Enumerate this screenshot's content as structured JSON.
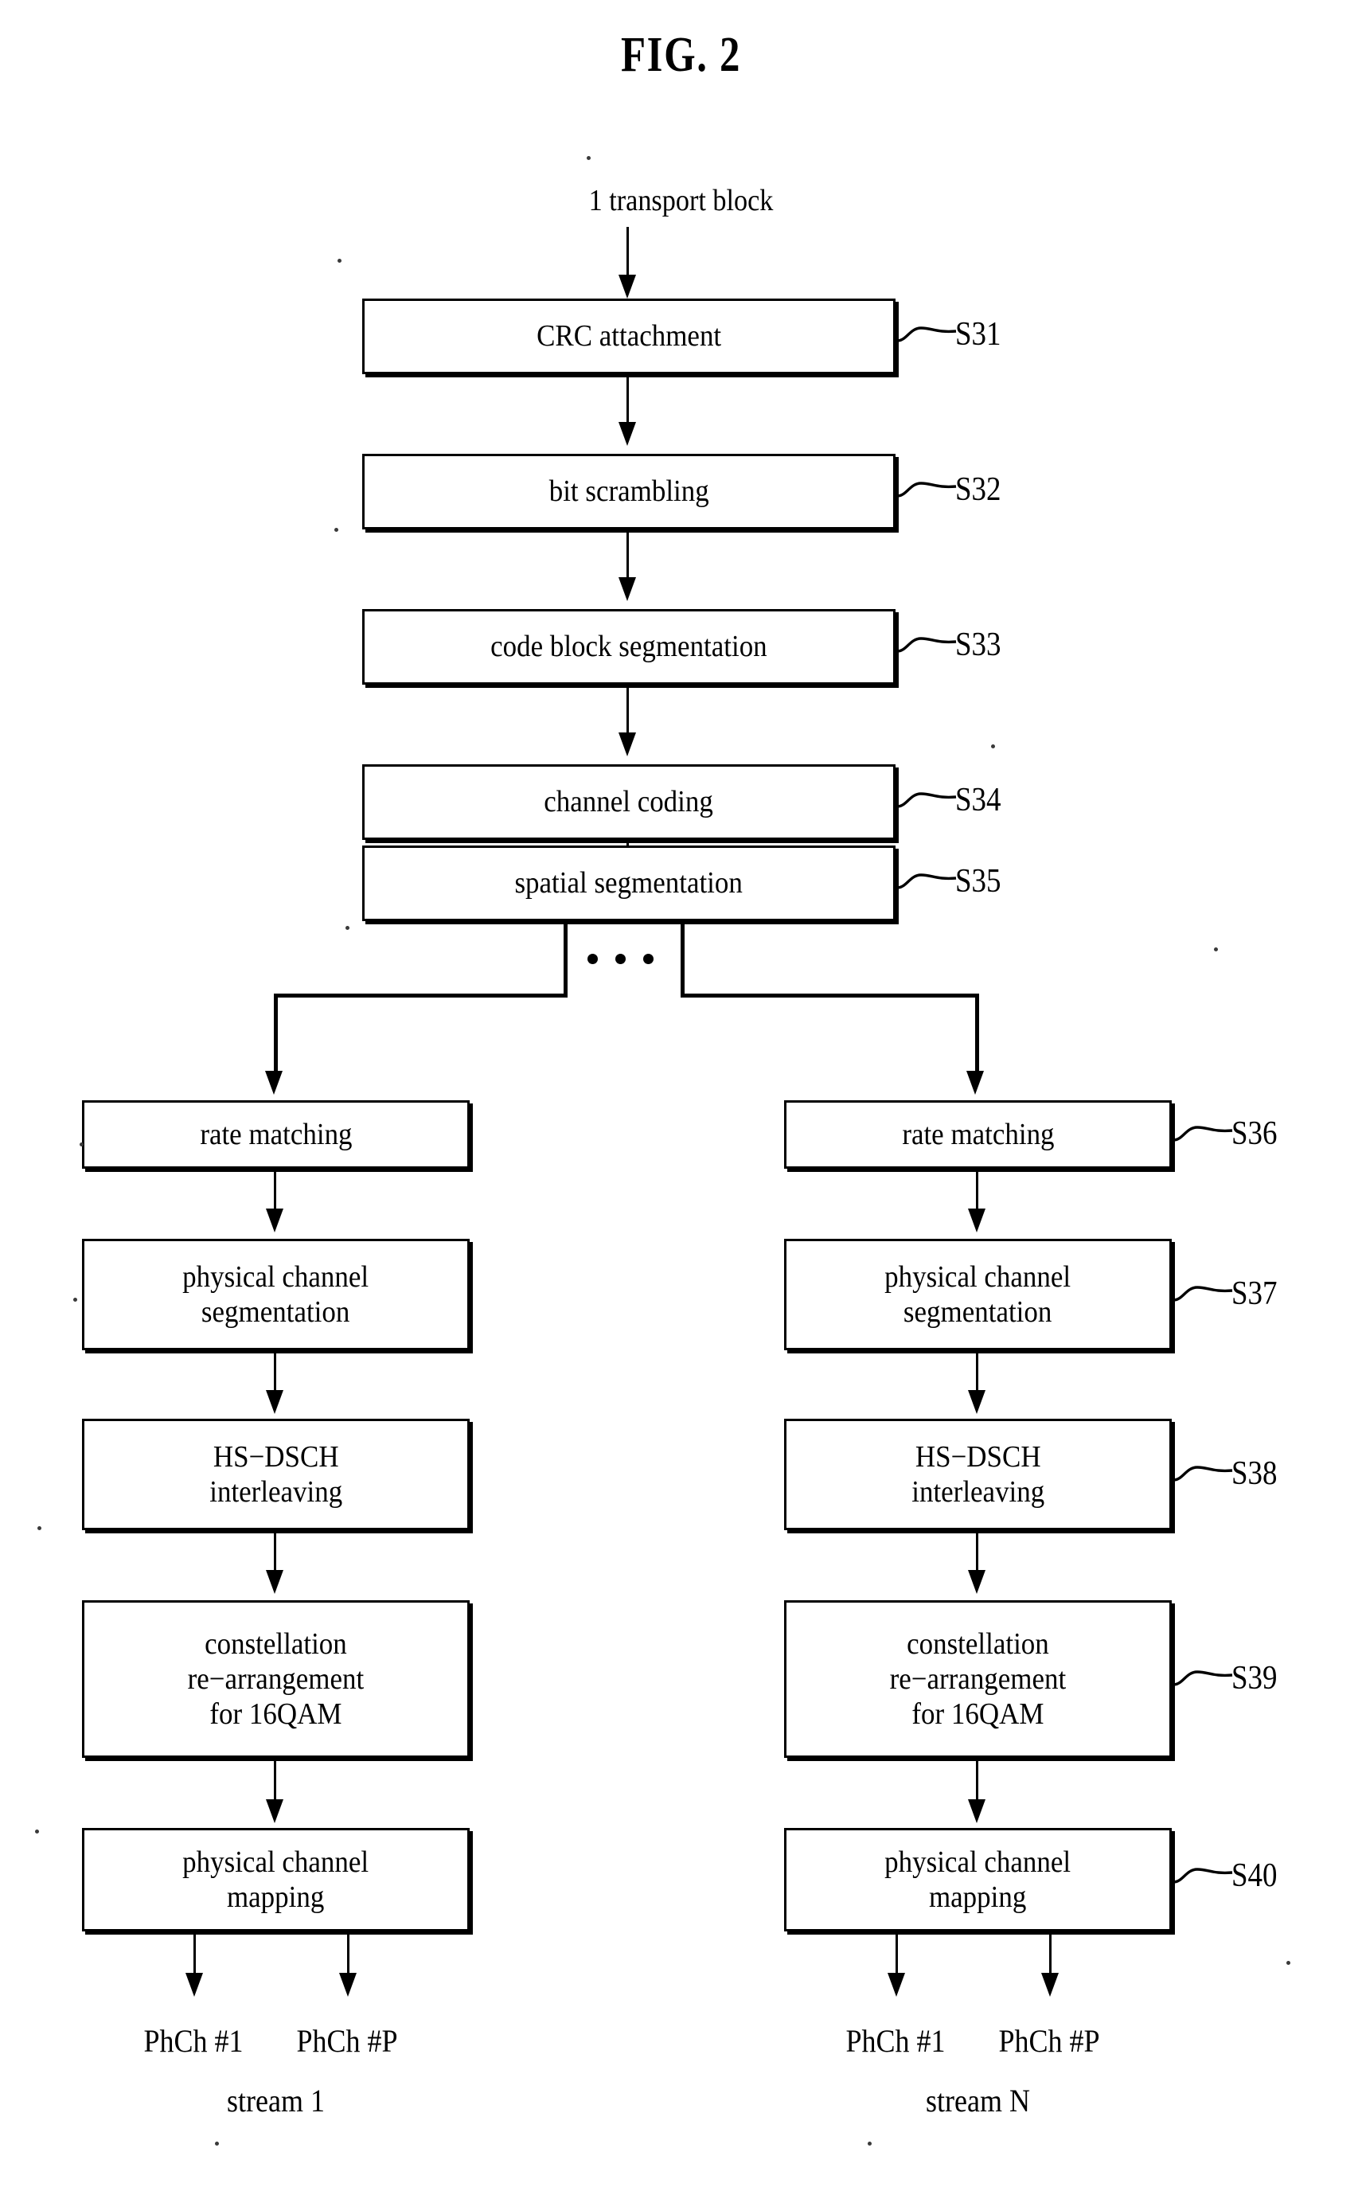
{
  "figure": {
    "title": "FIG. 2",
    "input_label": "1 transport block",
    "ellipsis": "• • •"
  },
  "common_steps": [
    {
      "id": "S31",
      "label": "CRC attachment"
    },
    {
      "id": "S32",
      "label": "bit scrambling"
    },
    {
      "id": "S33",
      "label": "code block segmentation"
    },
    {
      "id": "S34",
      "label": "channel coding"
    },
    {
      "id": "S35",
      "label": "spatial segmentation"
    }
  ],
  "branch_steps": [
    {
      "id": "S36",
      "label": "rate matching"
    },
    {
      "id": "S37",
      "label": "physical channel\nsegmentation"
    },
    {
      "id": "S38",
      "label": "HS−DSCH\ninterleaving"
    },
    {
      "id": "S39",
      "label": "constellation\nre−arrangement\nfor 16QAM"
    },
    {
      "id": "S40",
      "label": "physical channel\nmapping"
    }
  ],
  "left_branch": {
    "steps": [
      {
        "label": "rate matching"
      },
      {
        "label": "physical channel\nsegmentation"
      },
      {
        "label": "HS−DSCH\ninterleaving"
      },
      {
        "label": "constellation\nre−arrangement\nfor 16QAM"
      },
      {
        "label": "physical channel\nmapping"
      }
    ],
    "outputs": [
      "PhCh #1",
      "PhCh #P"
    ],
    "stream_label": "stream 1"
  },
  "right_branch": {
    "steps": [
      {
        "label": "rate matching"
      },
      {
        "label": "physical channel\nsegmentation"
      },
      {
        "label": "HS−DSCH\ninterleaving"
      },
      {
        "label": "constellation\nre−arrangement\nfor 16QAM"
      },
      {
        "label": "physical channel\nmapping"
      }
    ],
    "outputs": [
      "PhCh #1",
      "PhCh #P"
    ],
    "stream_label": "stream N"
  },
  "colors": {
    "ink": "#000000",
    "paper": "#ffffff"
  }
}
